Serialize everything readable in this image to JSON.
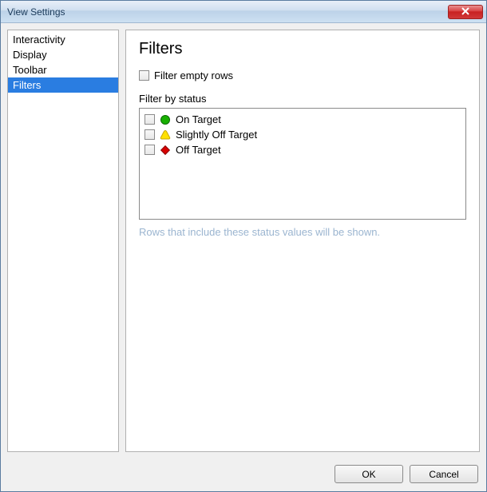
{
  "window": {
    "title": "View Settings"
  },
  "sidebar": {
    "items": [
      {
        "label": "Interactivity",
        "selected": false
      },
      {
        "label": "Display",
        "selected": false
      },
      {
        "label": "Toolbar",
        "selected": false
      },
      {
        "label": "Filters",
        "selected": true
      }
    ]
  },
  "main": {
    "heading": "Filters",
    "filter_empty_rows_label": "Filter empty rows",
    "filter_empty_rows_checked": false,
    "filter_by_status_label": "Filter by status",
    "status_items": [
      {
        "label": "On Target",
        "icon": "circle-green",
        "checked": false
      },
      {
        "label": "Slightly Off Target",
        "icon": "triangle-yellow",
        "checked": false
      },
      {
        "label": "Off Target",
        "icon": "diamond-red",
        "checked": false
      }
    ],
    "hint": "Rows that include these status values will be shown."
  },
  "footer": {
    "ok_label": "OK",
    "cancel_label": "Cancel"
  }
}
